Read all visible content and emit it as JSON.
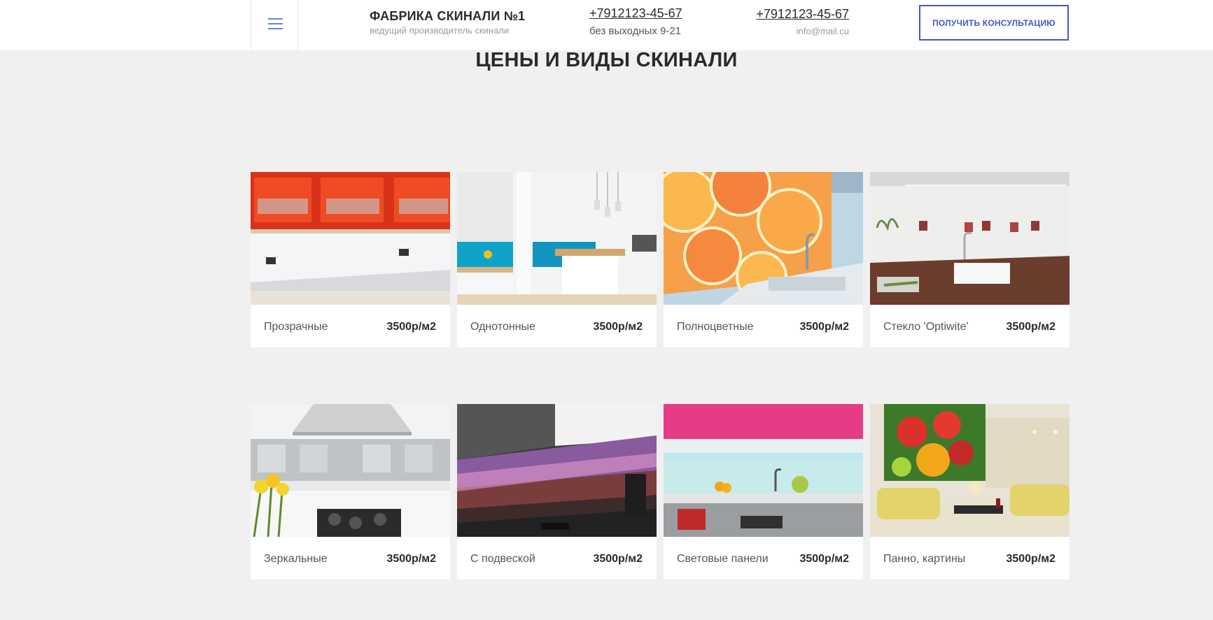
{
  "header": {
    "brand_title": "ФАБРИКА СКИНАЛИ №1",
    "brand_subtitle": "ведущий производитель скинали",
    "phone1": "+7912123-45-67",
    "hours": "без выходных 9-21",
    "phone2": "+7912123-45-67",
    "email": "info@mail.cu",
    "cta_label": "ПОЛУЧИТЬ КОНСУЛЬТАЦИЮ",
    "menu_icon": "hamburger-icon"
  },
  "section": {
    "title": "ЦЕНЫ И ВИДЫ СКИНАЛИ"
  },
  "products": [
    {
      "name": "Прозрачные",
      "price": "3500р/м2"
    },
    {
      "name": "Однотонные",
      "price": "3500р/м2"
    },
    {
      "name": "Полноцветные",
      "price": "3500р/м2"
    },
    {
      "name": "Стекло 'Optiwite'",
      "price": "3500р/м2"
    },
    {
      "name": "Зеркальные",
      "price": "3500р/м2"
    },
    {
      "name": "С подвеской",
      "price": "3500р/м2"
    },
    {
      "name": "Световые панели",
      "price": "3500р/м2"
    },
    {
      "name": "Панно, картины",
      "price": "3500р/м2"
    }
  ],
  "colors": {
    "accent": "#3f5ac8",
    "menu_icon": "#6f86c8",
    "background": "#f0f0f0"
  }
}
